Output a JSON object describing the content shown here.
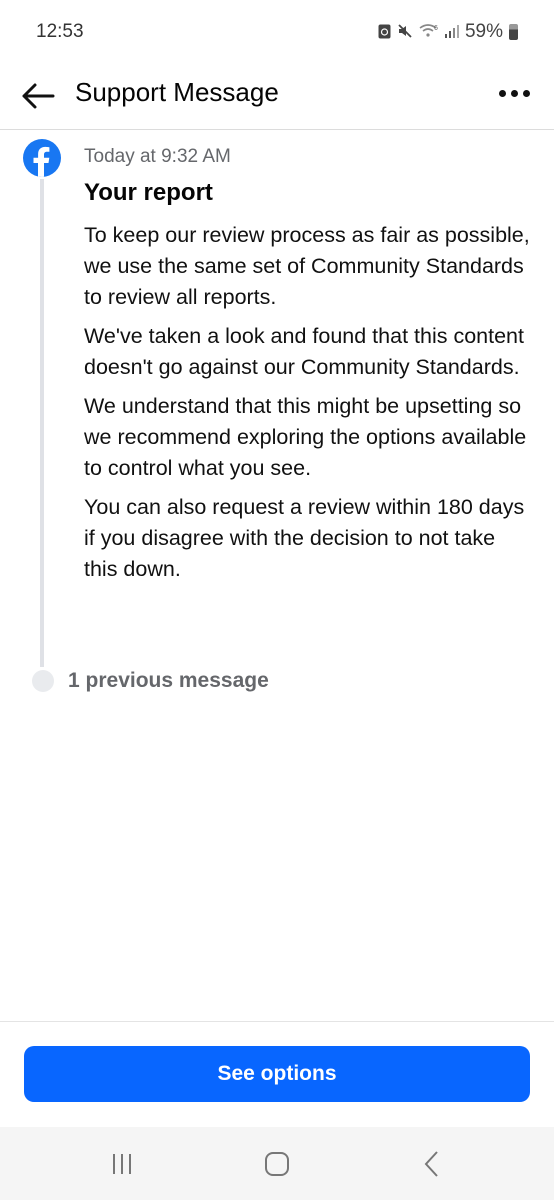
{
  "status_bar": {
    "time": "12:53",
    "battery_percent": "59%",
    "icons": [
      "battery-saver-icon",
      "mute-icon",
      "wifi-icon",
      "signal-icon",
      "battery-icon"
    ]
  },
  "app_bar": {
    "title": "Support Message",
    "back_icon": "arrow-left-icon",
    "more_icon": "more-horizontal-icon"
  },
  "message": {
    "sender_icon": "facebook-logo-icon",
    "timestamp": "Today at 9:32 AM",
    "title": "Your report",
    "paragraphs": [
      "To keep our review process as fair as possible, we use the same set of Community Standards to review all reports.",
      "We've taken a look and found that this content doesn't go against our Community Standards.",
      "We understand that this might be upsetting so we recommend exploring the options available to control what you see.",
      "You can also request a review within 180 days if you disagree with the decision to not take this down."
    ]
  },
  "previous": {
    "label": "1 previous message"
  },
  "footer": {
    "button_label": "See options",
    "button_color": "#0866ff"
  },
  "nav_bar": {
    "icons": [
      "recent-apps-icon",
      "home-icon",
      "back-icon"
    ]
  }
}
